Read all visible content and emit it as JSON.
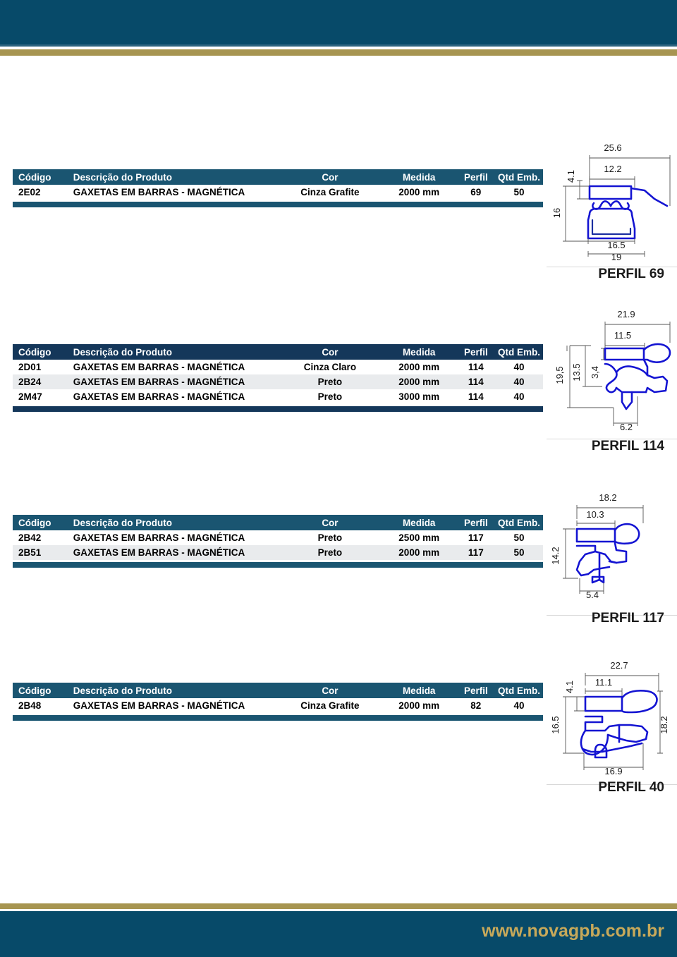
{
  "brand": {
    "url": "www.novagpb.com.br",
    "teal": "#074a69",
    "gold": "#a79551",
    "navy": "#14375a",
    "header_teal": "#1a5571",
    "profile_blue": "#1414d2"
  },
  "columns": {
    "codigo": "Código",
    "descricao": "Descrição do Produto",
    "cor": "Cor",
    "medida": "Medida",
    "perfil": "Perfil",
    "qtd": "Qtd Emb."
  },
  "tables": [
    {
      "style": "teal",
      "rows": [
        {
          "codigo": "2E02",
          "descricao": "GAXETAS EM BARRAS - MAGNÉTICA",
          "cor": "Cinza Grafite",
          "medida": "2000 mm",
          "perfil": "69",
          "qtd": "50"
        }
      ]
    },
    {
      "style": "navy",
      "rows": [
        {
          "codigo": "2D01",
          "descricao": "GAXETAS EM BARRAS - MAGNÉTICA",
          "cor": "Cinza Claro",
          "medida": "2000 mm",
          "perfil": "114",
          "qtd": "40"
        },
        {
          "codigo": "2B24",
          "descricao": "GAXETAS EM BARRAS - MAGNÉTICA",
          "cor": "Preto",
          "medida": "2000 mm",
          "perfil": "114",
          "qtd": "40"
        },
        {
          "codigo": "2M47",
          "descricao": "GAXETAS EM BARRAS - MAGNÉTICA",
          "cor": "Preto",
          "medida": "3000 mm",
          "perfil": "114",
          "qtd": "40"
        }
      ]
    },
    {
      "style": "teal",
      "rows": [
        {
          "codigo": "2B42",
          "descricao": "GAXETAS EM BARRAS - MAGNÉTICA",
          "cor": "Preto",
          "medida": "2500 mm",
          "perfil": "117",
          "qtd": "50"
        },
        {
          "codigo": "2B51",
          "descricao": "GAXETAS EM BARRAS - MAGNÉTICA",
          "cor": "Preto",
          "medida": "2000 mm",
          "perfil": "117",
          "qtd": "50"
        }
      ]
    },
    {
      "style": "teal",
      "rows": [
        {
          "codigo": "2B48",
          "descricao": "GAXETAS EM BARRAS - MAGNÉTICA",
          "cor": "Cinza Grafite",
          "medida": "2000 mm",
          "perfil": "82",
          "qtd": "40"
        }
      ]
    }
  ],
  "profiles": [
    {
      "label": "PERFIL 69",
      "dimensions": {
        "top": "25.6",
        "inner_top": "12.2",
        "left_small": "4.1",
        "left_tall": "16",
        "bottom_inner": "16.5",
        "bottom_outer": "19"
      }
    },
    {
      "label": "PERFIL 114",
      "dimensions": {
        "top": "21.9",
        "inner_top": "11.5",
        "left_tall": "19,5",
        "left_mid": "13.5",
        "left_small": "3,4",
        "bottom": "6.2"
      }
    },
    {
      "label": "PERFIL 117",
      "dimensions": {
        "top": "18.2",
        "inner_top": "10.3",
        "left_tall": "14.2",
        "bottom": "5.4"
      }
    },
    {
      "label": "PERFIL 40",
      "dimensions": {
        "top": "22.7",
        "inner_top": "11.1",
        "small_top": "4.1",
        "left_tall": "16.5",
        "right_tall": "18.2",
        "bottom": "16.9"
      }
    }
  ]
}
